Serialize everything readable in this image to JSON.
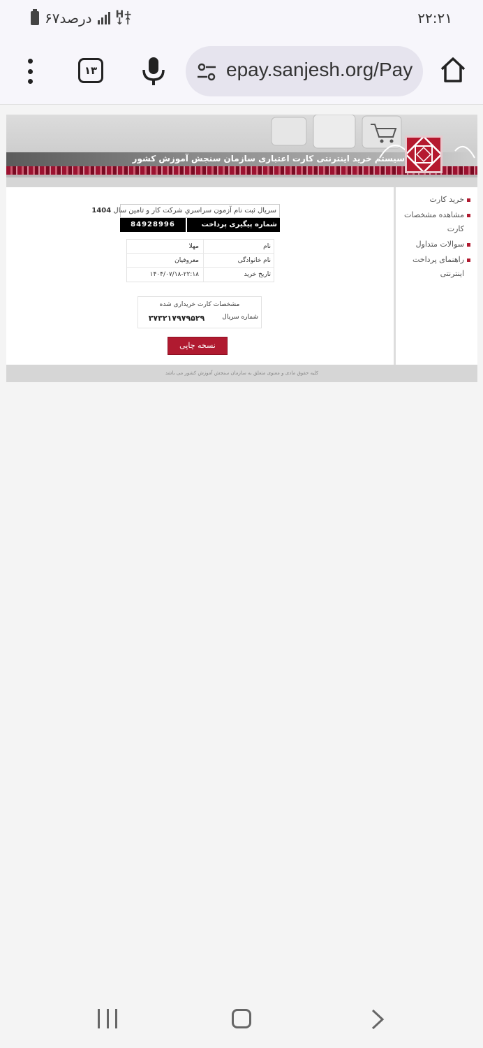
{
  "status_bar": {
    "time": "۲۲:۲۱",
    "battery_text": "۶۷درصد"
  },
  "browser": {
    "url": "epay.sanjesh.org/Pay",
    "tab_count": "۱۳"
  },
  "banner": {
    "title": "سیستم خرید اینترنتی کارت اعتباری سازمان سنجش آموزش کشور"
  },
  "sidebar": {
    "items": [
      {
        "label": "خرید کارت"
      },
      {
        "label": "مشاهده مشخصات کارت"
      },
      {
        "label": "سوالات متداول"
      },
      {
        "label": "راهنمای پرداخت اینترنتی"
      }
    ]
  },
  "receipt": {
    "serial_title": "سریال ثبت نام آزمون سراسري شرکت کار و تامین سال",
    "serial_year": "1404",
    "tracking_label": "شماره پیگیری پرداخت",
    "tracking_value": "84928996",
    "rows": [
      {
        "label": "نام",
        "value": "مهلا"
      },
      {
        "label": "نام خانوادگی",
        "value": "معروفیان"
      },
      {
        "label": "تاریخ خرید",
        "value": "۱۴۰۴/۰۷/۱۸-۲۲:۱۸"
      }
    ],
    "card_title": "مشخصات کارت خریداری شده",
    "card_serial_label": "شماره سریال",
    "card_serial_value": "۳۷۳۲۱۷۹۷۹۵۲۹",
    "print_button": "نسخه چاپی"
  },
  "footer": {
    "text": "کلیه حقوق مادی و معنوی متعلق به سازمان سنجش آموزش کشور می باشد"
  },
  "colors": {
    "accent": "#b01a30",
    "page_bg": "#f4f4f4"
  }
}
